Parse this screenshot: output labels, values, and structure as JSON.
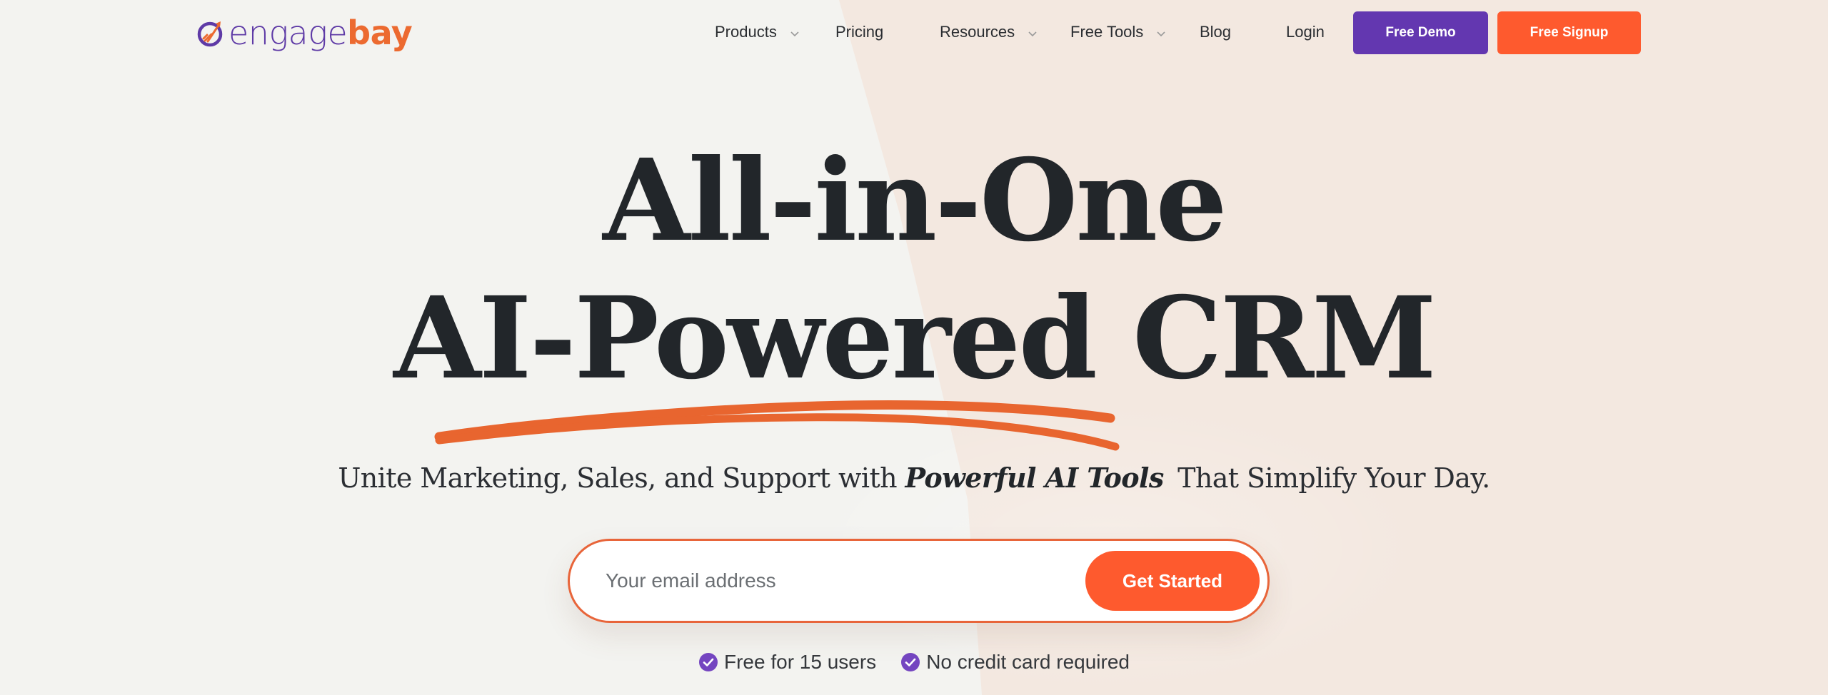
{
  "brand": {
    "name_part1": "engage",
    "name_part2": "bay",
    "colors": {
      "purple": "#5e3aa6",
      "orange": "#ec6a30",
      "cta_orange": "#fe5a2e",
      "demo_purple": "#6337b0"
    }
  },
  "nav": {
    "items": [
      {
        "label": "Products",
        "dropdown": true
      },
      {
        "label": "Pricing",
        "dropdown": false
      },
      {
        "label": "Resources",
        "dropdown": true
      },
      {
        "label": "Free Tools",
        "dropdown": true
      },
      {
        "label": "Blog",
        "dropdown": false
      },
      {
        "label": "Login",
        "dropdown": false
      }
    ],
    "demo_button": "Free Demo",
    "signup_button": "Free Signup"
  },
  "hero": {
    "title_line1": "All-in-One",
    "title_line2": "AI-Powered CRM",
    "subtitle_before": "Unite Marketing, Sales, and Support with ",
    "subtitle_emphasis": "Powerful AI Tools",
    "subtitle_after": " That Simplify Your Day.",
    "email_placeholder": "Your email address",
    "email_value": "",
    "cta_button": "Get Started",
    "perks": [
      {
        "icon": "check-circle-icon",
        "label": "Free for 15 users"
      },
      {
        "icon": "check-circle-icon",
        "label": "No credit card required"
      }
    ]
  }
}
